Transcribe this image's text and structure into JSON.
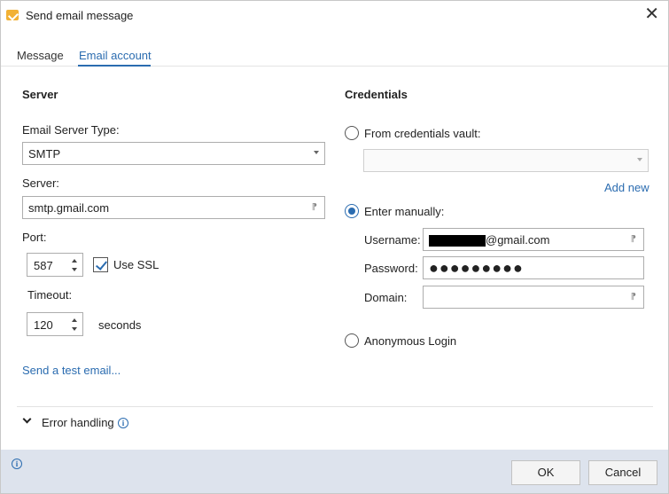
{
  "window": {
    "title": "Send email message",
    "close_glyph": "✕"
  },
  "tabs": [
    {
      "label": "Message",
      "active": false
    },
    {
      "label": "Email account",
      "active": true
    }
  ],
  "server": {
    "section_title": "Server",
    "type_label": "Email Server Type:",
    "type_value": "SMTP",
    "server_label": "Server:",
    "server_value": "smtp.gmail.com",
    "port_label": "Port:",
    "port_value": "587",
    "use_ssl_label": "Use SSL",
    "use_ssl_checked": true,
    "timeout_label": "Timeout:",
    "timeout_value": "120",
    "timeout_unit": "seconds",
    "test_link": "Send a test email..."
  },
  "credentials": {
    "section_title": "Credentials",
    "vault_option": "From credentials vault:",
    "vault_value": "",
    "add_new": "Add new",
    "manual_option": "Enter manually:",
    "username_label": "Username:",
    "username_suffix": "@gmail.com",
    "password_label": "Password:",
    "password_mask": "●●●●●●●●●",
    "domain_label": "Domain:",
    "domain_value": "",
    "anonymous_option": "Anonymous Login"
  },
  "error_handling": {
    "label": "Error handling"
  },
  "footer": {
    "ok_label": "OK",
    "cancel_label": "Cancel"
  },
  "icons": {
    "info": "i"
  },
  "colors": {
    "accent": "#2b6cb0",
    "footer_bg": "#dde3ed",
    "app_icon": "#f2b134"
  }
}
